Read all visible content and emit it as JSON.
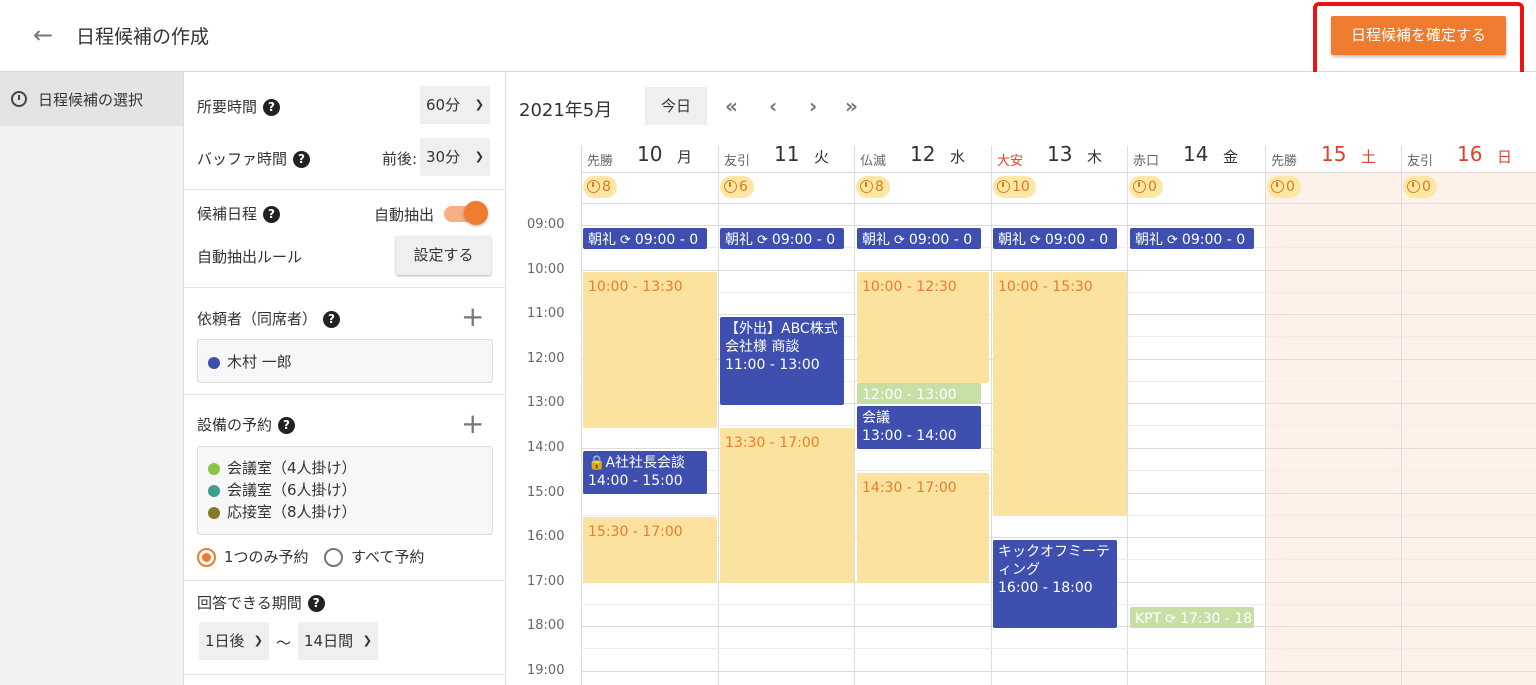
{
  "header": {
    "title": "日程候補の作成",
    "confirm_label": "日程候補を確定する"
  },
  "nav": {
    "item_label": "日程候補の選択"
  },
  "settings": {
    "duration_label": "所要時間",
    "duration_value": "60分",
    "buffer_label": "バッファ時間",
    "buffer_prefix": "前後:",
    "buffer_value": "30分",
    "candidate_label": "候補日程",
    "auto_label": "自動抽出",
    "auto_rule_label": "自動抽出ルール",
    "set_button": "設定する",
    "requester_label": "依頼者（同席者）",
    "requester_person": "木村 一郎",
    "facility_label": "設備の予約",
    "rooms": [
      {
        "label": "会議室（4人掛け）",
        "color": "#8bc34a"
      },
      {
        "label": "会議室（6人掛け）",
        "color": "#3f9e8c"
      },
      {
        "label": "応接室（8人掛け）",
        "color": "#847a2a"
      }
    ],
    "radio_one": "1つのみ予約",
    "radio_all": "すべて予約",
    "period_label": "回答できる期間",
    "period_from": "1日後",
    "period_sep": "〜",
    "period_to": "14日間"
  },
  "calendar": {
    "month": "2021年5月",
    "today_label": "今日",
    "times": [
      "09:00",
      "10:00",
      "11:00",
      "12:00",
      "13:00",
      "14:00",
      "15:00",
      "16:00",
      "17:00",
      "18:00",
      "19:00"
    ],
    "days": [
      {
        "rokuyo": "先勝",
        "num": "10",
        "dow": "月",
        "count": "8",
        "rokuyo_red": false,
        "weekend": false
      },
      {
        "rokuyo": "友引",
        "num": "11",
        "dow": "火",
        "count": "6",
        "rokuyo_red": false,
        "weekend": false
      },
      {
        "rokuyo": "仏滅",
        "num": "12",
        "dow": "水",
        "count": "8",
        "rokuyo_red": false,
        "weekend": false
      },
      {
        "rokuyo": "大安",
        "num": "13",
        "dow": "木",
        "count": "10",
        "rokuyo_red": true,
        "weekend": false
      },
      {
        "rokuyo": "赤口",
        "num": "14",
        "dow": "金",
        "count": "0",
        "rokuyo_red": false,
        "weekend": false
      },
      {
        "rokuyo": "先勝",
        "num": "15",
        "dow": "土",
        "count": "0",
        "rokuyo_red": false,
        "weekend": true
      },
      {
        "rokuyo": "友引",
        "num": "16",
        "dow": "日",
        "count": "0",
        "rokuyo_red": false,
        "weekend": true
      }
    ],
    "events": {
      "morning_title": "朝礼",
      "morning_time": "09:00 - 0",
      "mon_cand1": "10:00 - 13:30",
      "mon_meeting_title": "A社社長会談",
      "mon_meeting_time": "14:00 - 15:00",
      "mon_cand2": "15:30 - 17:00",
      "tue_out_title": "【外出】ABC株式会社様 商談",
      "tue_out_time": "11:00 - 13:00",
      "tue_cand": "13:30 - 17:00",
      "wed_cand1": "10:00 - 12:30",
      "wed_green": "12:00 - 13:00",
      "wed_meeting_title": "会議",
      "wed_meeting_time": "13:00 - 14:00",
      "wed_cand2": "14:30 - 17:00",
      "thu_cand": "10:00 - 15:30",
      "thu_kick_title": "キックオフミーティング",
      "thu_kick_time": "16:00 - 18:00",
      "fri_kpt_title": "KPT",
      "fri_kpt_time": "17:30 - 18"
    }
  }
}
